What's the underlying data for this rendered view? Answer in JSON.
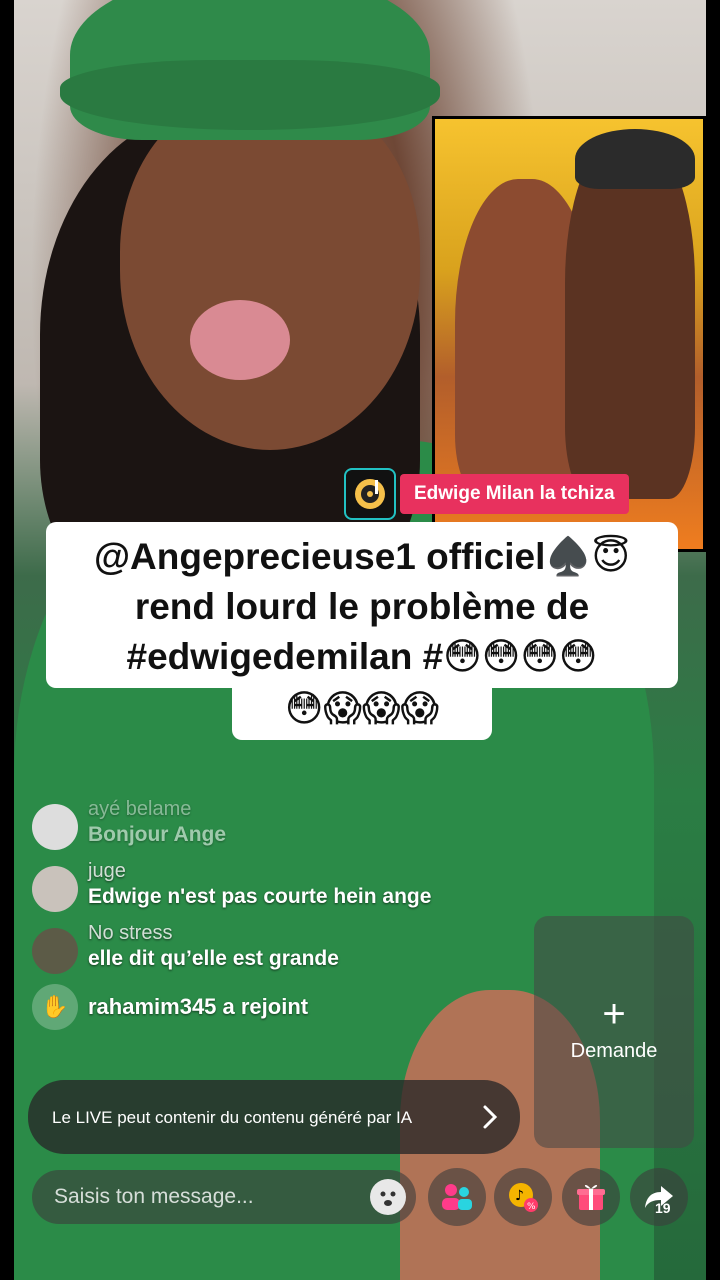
{
  "music": {
    "icon": "music-disc-icon",
    "label": "Edwige Milan la tchiza"
  },
  "caption": {
    "line_main": "@Angeprecieuse1 officiel♠️😇 rend lourd le problème de #edwigedemilan #😳😳😳😳",
    "line_tail": "😳😱😱😱"
  },
  "comments": [
    {
      "user": "ayé belame",
      "message": "Bonjour Ange"
    },
    {
      "user": "juge",
      "message": "Edwige n'est pas courte hein ange"
    },
    {
      "user": "No stress",
      "message": "elle dit qu’elle est grande"
    }
  ],
  "join": {
    "text": "rahamim345 a rejoint",
    "icon": "wave-hand-icon"
  },
  "notice": {
    "text": "Le LIVE peut contenir du contenu généré par IA"
  },
  "demande": {
    "plus": "+",
    "label": "Demande"
  },
  "input": {
    "placeholder": "Saisis ton message..."
  },
  "actions": {
    "icons": [
      "smiley-icon",
      "guests-icon",
      "promo-icon",
      "gift-icon",
      "share-icon"
    ],
    "share_count": "19"
  },
  "colors": {
    "accent": "#e8315e",
    "teal": "#22c1c3"
  }
}
